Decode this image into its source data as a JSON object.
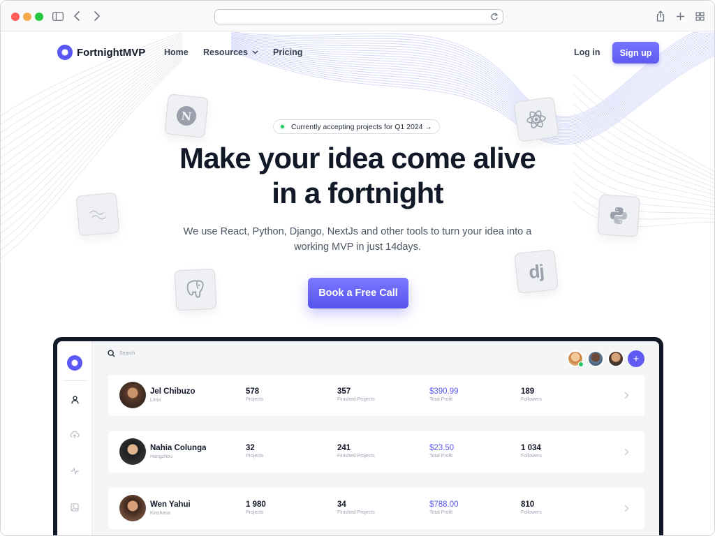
{
  "browser": {
    "url": "",
    "icons": [
      "sidebar-toggle-icon",
      "back-icon",
      "forward-icon",
      "reload-icon",
      "share-icon",
      "new-tab-icon",
      "tabs-overview-icon"
    ]
  },
  "nav": {
    "brand": "FortnightMVP",
    "links": [
      "Home",
      "Resources",
      "Pricing"
    ],
    "login": "Log in",
    "signup": "Sign up"
  },
  "hero": {
    "badge": "Currently accepting projects for Q1 2024 →",
    "title_line1": "Make your idea come alive",
    "title_line2": "in a fortnight",
    "subtitle_line1": "We use React, Python, Django, NextJs and other tools to turn your idea into a",
    "subtitle_line2": "working MVP in just 14days.",
    "cta": "Book a Free Call"
  },
  "tech_tiles": {
    "nextjs_letter": "N",
    "django_letters": "dj"
  },
  "colors": {
    "accent": "#5b57f5",
    "text": "#111827",
    "muted": "#4b5563"
  },
  "dashboard": {
    "search_placeholder": "Search",
    "add_label": "+",
    "rows": [
      {
        "name": "Jel Chibuzo",
        "city": "Lima",
        "projects": "578",
        "projects_label": "Projects",
        "finished": "357",
        "finished_label": "Finished Projects",
        "profit": "$390.99",
        "profit_label": "Total Profit",
        "followers": "189",
        "followers_label": "Followers"
      },
      {
        "name": "Nahia Colunga",
        "city": "Hangzhou",
        "projects": "32",
        "projects_label": "Projects",
        "finished": "241",
        "finished_label": "Finished Projects",
        "profit": "$23.50",
        "profit_label": "Total Profit",
        "followers": "1 034",
        "followers_label": "Followers"
      },
      {
        "name": "Wen Yahui",
        "city": "Kinshasa",
        "projects": "1 980",
        "projects_label": "Projects",
        "finished": "34",
        "finished_label": "Finished Projects",
        "profit": "$788.00",
        "profit_label": "Total Profit",
        "followers": "810",
        "followers_label": "Followers"
      }
    ]
  }
}
